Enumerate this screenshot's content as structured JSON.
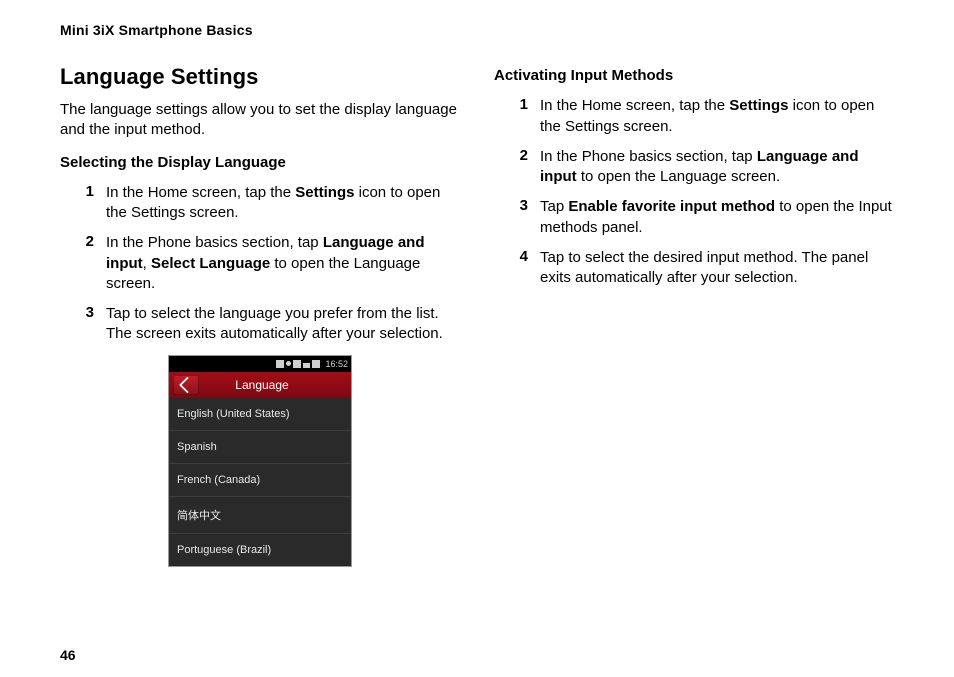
{
  "runningHead": "Mini 3iX Smartphone Basics",
  "pageNumber": "46",
  "left": {
    "title": "Language Settings",
    "intro": "The language settings allow you to set the display language and the input method.",
    "subhead": "Selecting the Display Language",
    "steps": {
      "s1": {
        "num": "1",
        "pre": "In the Home screen, tap the ",
        "b1": "Settings",
        "post": " icon to open the Settings screen."
      },
      "s2": {
        "num": "2",
        "pre": "In the Phone basics section, tap ",
        "b1": "Language and input",
        "mid": ", ",
        "b2": "Select Language",
        "post": " to open the Language screen."
      },
      "s3": {
        "num": "3",
        "text": "Tap to select the language you prefer from the list. The screen exits automatically after your selection."
      }
    }
  },
  "right": {
    "subhead": "Activating Input Methods",
    "steps": {
      "s1": {
        "num": "1",
        "pre": "In the Home screen, tap the ",
        "b1": "Settings",
        "post": " icon to open the Settings screen."
      },
      "s2": {
        "num": "2",
        "pre": "In the Phone basics section, tap ",
        "b1": "Language and input",
        "post": " to open the Language screen."
      },
      "s3": {
        "num": "3",
        "pre": "Tap ",
        "b1": "Enable favorite input method",
        "post": " to open the Input methods panel."
      },
      "s4": {
        "num": "4",
        "text": "Tap to select the desired input method. The panel exits automatically after your selection."
      }
    }
  },
  "phone": {
    "time": "16:52",
    "title": "Language",
    "items": {
      "i0": "English (United States)",
      "i1": "Spanish",
      "i2": "French (Canada)",
      "i3": "简体中文",
      "i4": "Portuguese (Brazil)"
    }
  }
}
